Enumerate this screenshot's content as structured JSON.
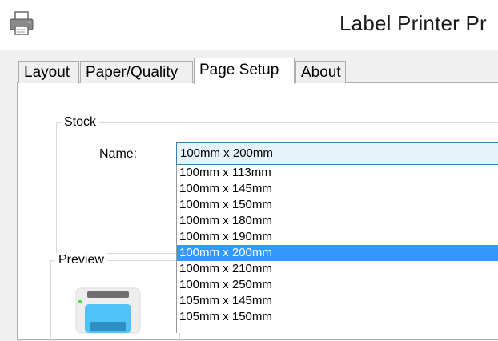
{
  "window": {
    "title": "Label Printer Pr"
  },
  "tabs": [
    {
      "label": "Layout"
    },
    {
      "label": "Paper/Quality"
    },
    {
      "label": "Page Setup",
      "active": true
    },
    {
      "label": "About"
    }
  ],
  "stock": {
    "group_title": "Stock",
    "name_label": "Name:",
    "selected_value": "100mm x 200mm",
    "options": [
      "100mm x 113mm",
      "100mm x 145mm",
      "100mm x 150mm",
      "100mm x 180mm",
      "100mm x 190mm",
      "100mm x 200mm",
      "100mm x 210mm",
      "100mm x 250mm",
      "105mm x 145mm",
      "105mm x 150mm"
    ],
    "highlighted_option": "100mm x 200mm"
  },
  "preview": {
    "group_title": "Preview"
  },
  "colors": {
    "selection": "#3399ff",
    "combo_background": "#e5f3fb",
    "printer_body": "#4fc3f7"
  },
  "icons": {
    "app": "printer-icon",
    "preview": "printer-preview-icon"
  }
}
